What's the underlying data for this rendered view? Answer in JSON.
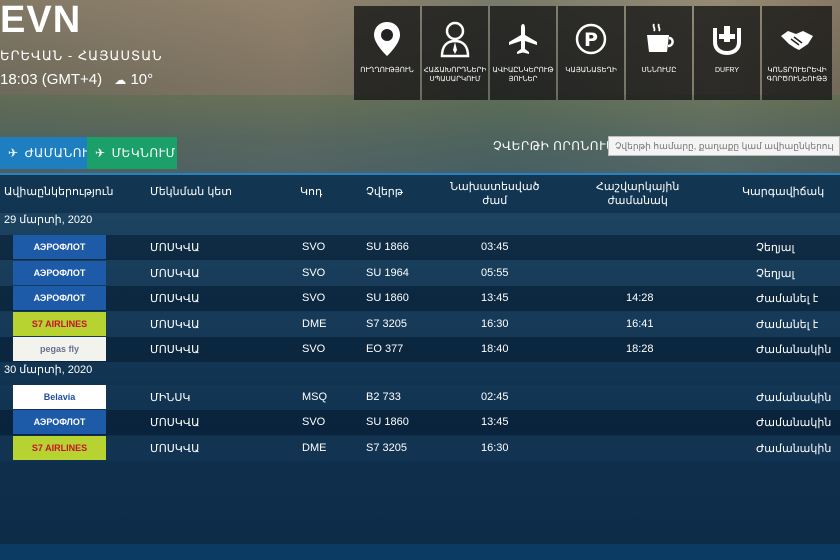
{
  "brand": {
    "code": "EVN",
    "location": "ԵՐԵՎԱՆ - ՀԱՅԱՍՏԱՆ",
    "time": "18:03 (GMT+4)",
    "temperature": "10°"
  },
  "menu": [
    {
      "label": "ՈՒՂՂՈՒԹՅՈՒՆ",
      "icon": "location-pin-icon"
    },
    {
      "label": "ՀԱՃԱԽՈՐԴՆԵՐԻ ՍՊԱՍԱՐԿՈՒՄ",
      "icon": "passenger-service-icon"
    },
    {
      "label": "ԱՎԻԱԸՆԿԵՐՈՒԹ ՅՈՒՆԵՐ",
      "icon": "airplane-icon"
    },
    {
      "label": "ԿԱՅԱՆԱՏԵՂԻ",
      "icon": "parking-icon"
    },
    {
      "label": "ՍՆՆՈՒՄԸ",
      "icon": "coffee-cup-icon"
    },
    {
      "label": "DUFRY",
      "icon": "dufry-icon"
    },
    {
      "label": "ԿՈՆՏՐՈՒԵՐԵՎԻ ԳՈՐԾՈՒՆԵՈՒԹՅ",
      "icon": "handshake-icon"
    }
  ],
  "tabs": {
    "arrivals": "ԺԱՄԱՆՈՒՄ",
    "departures": "ՄԵԿՆՈՒՄ"
  },
  "search": {
    "label": "ՉՎԵՐԹԻ ՈՐՈՆՈՒՄ",
    "placeholder": "Չվերթի համարը, քաղաքը կամ ավիաընկերությունը"
  },
  "table": {
    "headers": {
      "airline": "Ավիաընկերություն",
      "origin": "Մեկնման կետ",
      "code": "Կոդ",
      "flight": "Չվերթ",
      "scheduled_1": "Նախատեսված",
      "scheduled_2": "ժամ",
      "estimated_1": "Հաշվարկային",
      "estimated_2": "ժամանակ",
      "status": "Կարգավիճակ"
    },
    "groups": [
      {
        "date": "29 մարտի, 2020",
        "rows": [
          {
            "airline": "aeroflot",
            "origin": "ՄՈՍԿՎԱ",
            "code": "SVO",
            "flight": "SU 1866",
            "scheduled": "03:45",
            "estimated": "",
            "status": "Չեղյալ"
          },
          {
            "airline": "aeroflot",
            "origin": "ՄՈՍԿՎԱ",
            "code": "SVO",
            "flight": "SU 1964",
            "scheduled": "05:55",
            "estimated": "",
            "status": "Չեղյալ"
          },
          {
            "airline": "aeroflot",
            "origin": "ՄՈՍԿՎԱ",
            "code": "SVO",
            "flight": "SU 1860",
            "scheduled": "13:45",
            "estimated": "14:28",
            "status": "Ժամանել է"
          },
          {
            "airline": "s7",
            "origin": "ՄՈՍԿՎԱ",
            "code": "DME",
            "flight": "S7 3205",
            "scheduled": "16:30",
            "estimated": "16:41",
            "status": "Ժամանել է"
          },
          {
            "airline": "pegas",
            "origin": "ՄՈՍԿՎԱ",
            "code": "SVO",
            "flight": "EO 377",
            "scheduled": "18:40",
            "estimated": "18:28",
            "status": "Ժամանակին"
          }
        ]
      },
      {
        "date": "30 մարտի, 2020",
        "rows": [
          {
            "airline": "belavia",
            "origin": "ՄԻՆՍԿ",
            "code": "MSQ",
            "flight": "B2 733",
            "scheduled": "02:45",
            "estimated": "",
            "status": "Ժամանակին"
          },
          {
            "airline": "aeroflot",
            "origin": "ՄՈՍԿՎԱ",
            "code": "SVO",
            "flight": "SU 1860",
            "scheduled": "13:45",
            "estimated": "",
            "status": "Ժամանակին"
          },
          {
            "airline": "s7",
            "origin": "ՄՈՍԿՎԱ",
            "code": "DME",
            "flight": "S7 3205",
            "scheduled": "16:30",
            "estimated": "",
            "status": "Ժամանակին"
          }
        ]
      }
    ]
  },
  "logos": {
    "aeroflot": {
      "text": "АЭРОФЛОТ",
      "color": "#ffffff"
    },
    "s7": {
      "text": "S7 AIRLINES",
      "color": "#c8102e"
    },
    "pegas": {
      "text": "pegas fly",
      "color": "#6a6f8c"
    },
    "belavia": {
      "text": "Belavia",
      "color": "#1d4f9c"
    }
  },
  "colors": {
    "tab_arrivals": "#1e7fc0",
    "tab_departures": "#1aa068",
    "accent_line": "#2583c4"
  }
}
